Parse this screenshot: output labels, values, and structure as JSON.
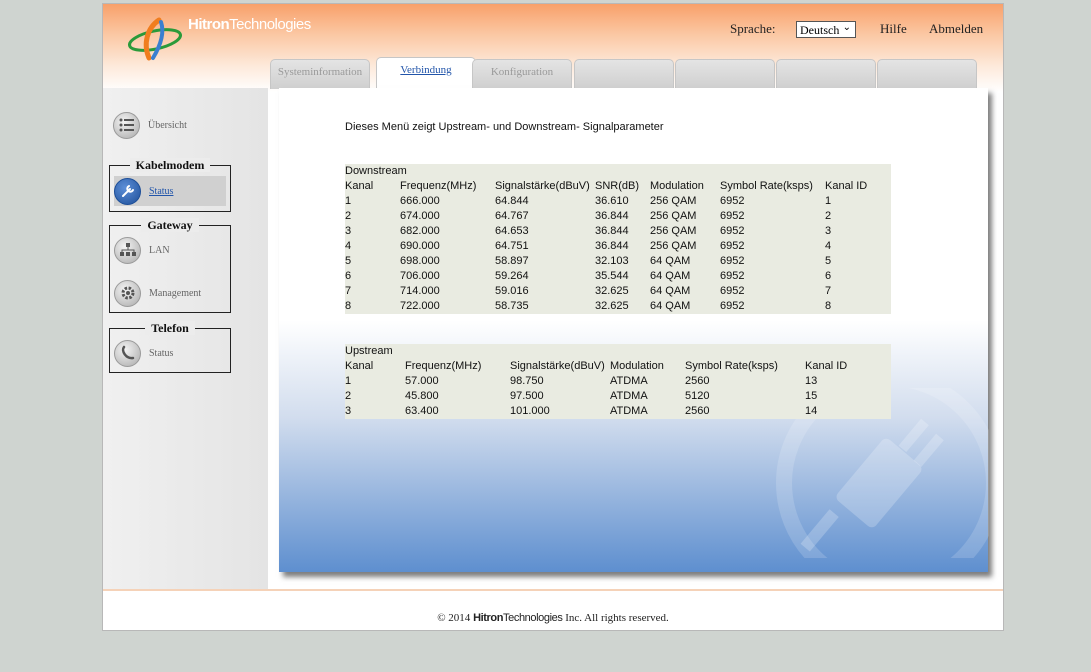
{
  "header": {
    "logo_bold": "Hitron",
    "logo_rest": "Technologies",
    "language_label": "Sprache:",
    "language_selected": "Deutsch",
    "help_label": "Hilfe",
    "logout_label": "Abmelden"
  },
  "tabs": [
    {
      "label": "Systeminformation",
      "active": false
    },
    {
      "label": "Verbindung",
      "active": true
    },
    {
      "label": "Konfiguration",
      "active": false
    },
    {
      "label": "",
      "active": false
    },
    {
      "label": "",
      "active": false
    },
    {
      "label": "",
      "active": false
    },
    {
      "label": "",
      "active": false
    }
  ],
  "sidebar": {
    "overview_label": "Übersicht",
    "groups": [
      {
        "title": "Kabelmodem",
        "items": [
          {
            "label": "Status",
            "icon": "wrench-icon",
            "selected": true
          }
        ]
      },
      {
        "title": "Gateway",
        "items": [
          {
            "label": "LAN",
            "icon": "network-icon"
          },
          {
            "label": "Management",
            "icon": "gear-icon"
          }
        ]
      },
      {
        "title": "Telefon",
        "items": [
          {
            "label": "Status",
            "icon": "phone-icon"
          }
        ]
      }
    ]
  },
  "content": {
    "intro": "Dieses Menü zeigt Upstream- und Downstream- Signalparameter",
    "downstream": {
      "title": "Downstream",
      "headers": [
        "Kanal",
        "Frequenz(MHz)",
        "Signalstärke(dBuV)",
        "SNR(dB)",
        "Modulation",
        "Symbol Rate(ksps)",
        "Kanal ID"
      ],
      "rows": [
        [
          "1",
          "666.000",
          "64.844",
          "36.610",
          "256 QAM",
          "6952",
          "1"
        ],
        [
          "2",
          "674.000",
          "64.767",
          "36.844",
          "256 QAM",
          "6952",
          "2"
        ],
        [
          "3",
          "682.000",
          "64.653",
          "36.844",
          "256 QAM",
          "6952",
          "3"
        ],
        [
          "4",
          "690.000",
          "64.751",
          "36.844",
          "256 QAM",
          "6952",
          "4"
        ],
        [
          "5",
          "698.000",
          "58.897",
          "32.103",
          "64 QAM",
          "6952",
          "5"
        ],
        [
          "6",
          "706.000",
          "59.264",
          "35.544",
          "64 QAM",
          "6952",
          "6"
        ],
        [
          "7",
          "714.000",
          "59.016",
          "32.625",
          "64 QAM",
          "6952",
          "7"
        ],
        [
          "8",
          "722.000",
          "58.735",
          "32.625",
          "64 QAM",
          "6952",
          "8"
        ]
      ]
    },
    "upstream": {
      "title": "Upstream",
      "headers": [
        "Kanal",
        "Frequenz(MHz)",
        "Signalstärke(dBuV)",
        "Modulation",
        "Symbol Rate(ksps)",
        "Kanal ID"
      ],
      "rows": [
        [
          "1",
          "57.000",
          "98.750",
          "ATDMA",
          "2560",
          "13"
        ],
        [
          "2",
          "45.800",
          "97.500",
          "ATDMA",
          "5120",
          "15"
        ],
        [
          "3",
          "63.400",
          "101.000",
          "ATDMA",
          "2560",
          "14"
        ]
      ]
    }
  },
  "footer": {
    "copyright": "© 2014",
    "brand_bold": "Hitron",
    "brand_rest": "Technologies",
    "rights": "Inc.  All rights reserved."
  },
  "colors": {
    "header_orange": "#f8a06a",
    "link_blue": "#2255aa",
    "table_bg": "#e9ebe1",
    "content_blue": "#5e8fcf"
  }
}
